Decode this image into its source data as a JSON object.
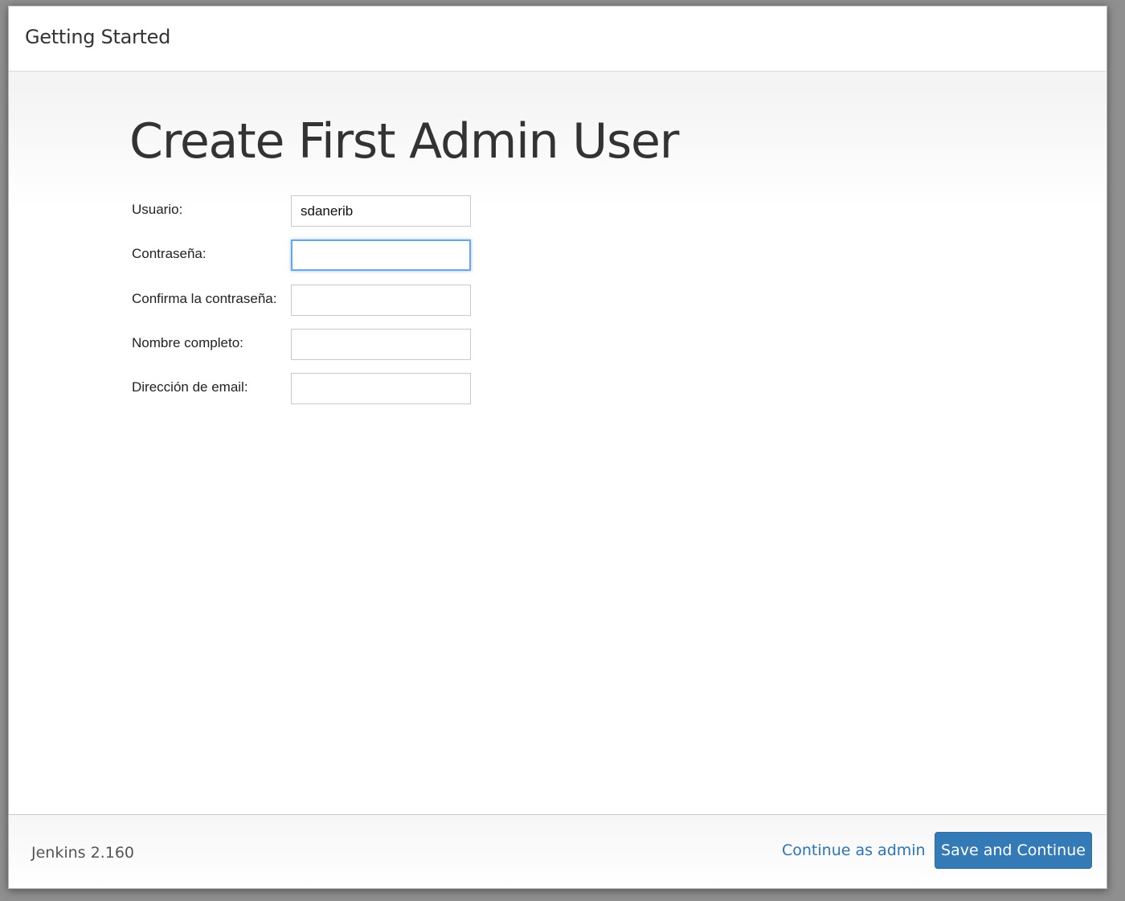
{
  "header": {
    "title": "Getting Started"
  },
  "main": {
    "heading": "Create First Admin User",
    "fields": [
      {
        "label": "Usuario:",
        "value": "sdanerib",
        "placeholder": ""
      },
      {
        "label": "Contraseña:",
        "value": "",
        "placeholder": ""
      },
      {
        "label": "Confirma la contraseña:",
        "value": "",
        "placeholder": ""
      },
      {
        "label": "Nombre completo:",
        "value": "",
        "placeholder": ""
      },
      {
        "label": "Dirección de email:",
        "value": "",
        "placeholder": ""
      }
    ]
  },
  "footer": {
    "version": "Jenkins 2.160",
    "continue_link": "Continue as admin",
    "save_button": "Save and Continue"
  },
  "colors": {
    "accent": "#337ab7",
    "link": "#2a74b8",
    "focus": "#6ba6e8"
  }
}
